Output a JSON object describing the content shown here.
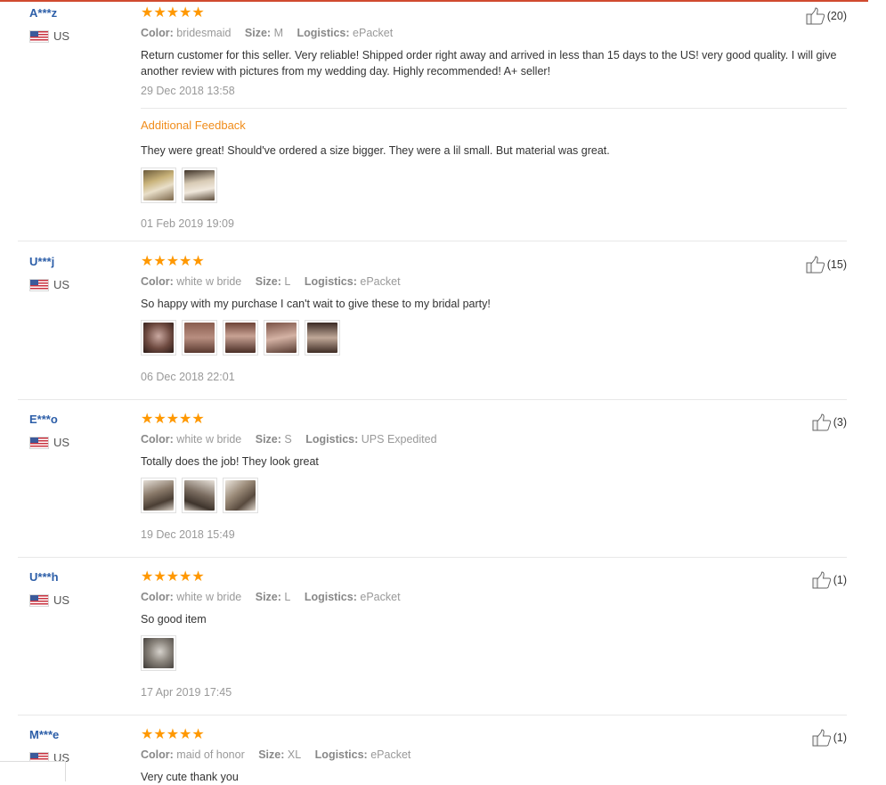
{
  "reviews": [
    {
      "user": "A***z",
      "country": "US",
      "stars": "★★★★★",
      "color_label": "Color:",
      "color": "bridesmaid",
      "size_label": "Size:",
      "size": "M",
      "logistics_label": "Logistics:",
      "logistics": "ePacket",
      "text": "Return customer for this seller. Very reliable! Shipped order right away and arrived in less than 15 days to the US! very good quality. I will give another review with pictures from my wedding day. Highly recommended! A+ seller!",
      "date": "29 Dec 2018 13:58",
      "likes": "(20)",
      "additional": {
        "title": "Additional Feedback",
        "text": "They were great! Should've ordered a size bigger. They were a lil small. But material was great.",
        "date": "01 Feb 2019 19:09"
      }
    },
    {
      "user": "U***j",
      "country": "US",
      "stars": "★★★★★",
      "color_label": "Color:",
      "color": "white w bride",
      "size_label": "Size:",
      "size": "L",
      "logistics_label": "Logistics:",
      "logistics": "ePacket",
      "text": "So happy with my purchase I can't wait to give these to my bridal party!",
      "date": "06 Dec 2018 22:01",
      "likes": "(15)"
    },
    {
      "user": "E***o",
      "country": "US",
      "stars": "★★★★★",
      "color_label": "Color:",
      "color": "white w bride",
      "size_label": "Size:",
      "size": "S",
      "logistics_label": "Logistics:",
      "logistics": "UPS Expedited",
      "text": "Totally does the job! They look great",
      "date": "19 Dec 2018 15:49",
      "likes": "(3)"
    },
    {
      "user": "U***h",
      "country": "US",
      "stars": "★★★★★",
      "color_label": "Color:",
      "color": "white w bride",
      "size_label": "Size:",
      "size": "L",
      "logistics_label": "Logistics:",
      "logistics": "ePacket",
      "text": "So good item",
      "date": "17 Apr 2019 17:45",
      "likes": "(1)"
    },
    {
      "user": "M***e",
      "country": "US",
      "stars": "★★★★★",
      "color_label": "Color:",
      "color": "maid of honor",
      "size_label": "Size:",
      "size": "XL",
      "logistics_label": "Logistics:",
      "logistics": "ePacket",
      "text": "Very cute thank you",
      "likes": "(1)"
    }
  ],
  "icons": {
    "like": "thumbs-up-icon",
    "flag": "us-flag-icon",
    "star": "star-icon"
  },
  "colors": {
    "username": "#2c5ea8",
    "stars": "#ff9800",
    "additional": "#f08c1a",
    "accent": "#d04a2f"
  }
}
